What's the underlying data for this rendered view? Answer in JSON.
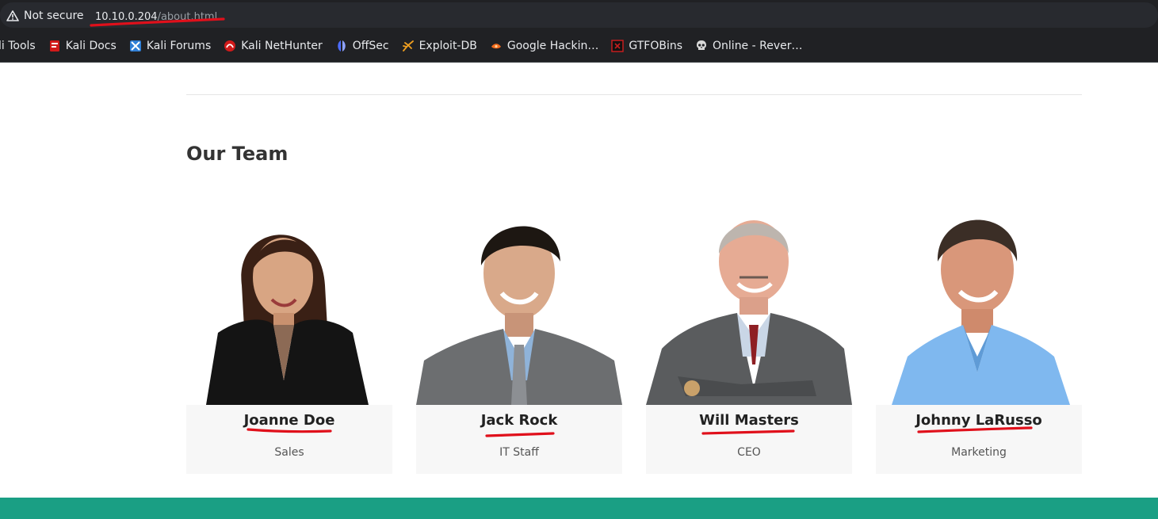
{
  "browser": {
    "security_label": "Not secure",
    "url_host": "10.10.0.204",
    "url_path": "/about.html",
    "bookmarks": [
      {
        "label": "li Tools",
        "icon": "none"
      },
      {
        "label": "Kali Docs",
        "icon": "kali-docs-icon"
      },
      {
        "label": "Kali Forums",
        "icon": "kali-forums-icon"
      },
      {
        "label": "Kali NetHunter",
        "icon": "kali-nethunter-icon"
      },
      {
        "label": "OffSec",
        "icon": "offsec-icon"
      },
      {
        "label": "Exploit-DB",
        "icon": "exploit-db-icon"
      },
      {
        "label": "Google Hackin…",
        "icon": "google-hacking-icon"
      },
      {
        "label": "GTFOBins",
        "icon": "gtfobins-icon"
      },
      {
        "label": "Online - Rever…",
        "icon": "skull-icon"
      }
    ]
  },
  "page": {
    "section_title": "Our Team",
    "team": [
      {
        "name": "Joanne Doe",
        "role": "Sales"
      },
      {
        "name": "Jack Rock",
        "role": "IT Staff"
      },
      {
        "name": "Will Masters",
        "role": "CEO"
      },
      {
        "name": "Johnny LaRusso",
        "role": "Marketing"
      }
    ]
  },
  "colors": {
    "accent_footer": "#1a9f84",
    "annotation_red": "#e0101b"
  }
}
